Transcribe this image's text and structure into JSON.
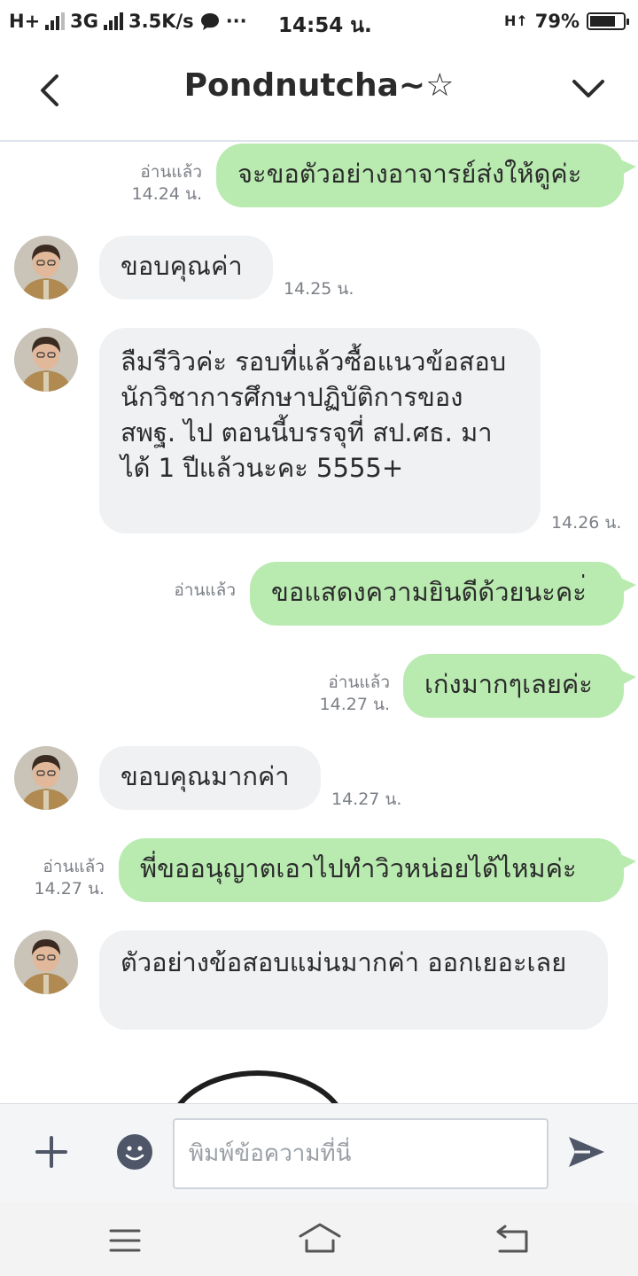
{
  "status_bar": {
    "left_network": "H+",
    "network_type": "3G",
    "speed": "3.5K/s",
    "more": "···",
    "time": "14:54 น.",
    "right_network": "H↑",
    "battery_percent_text": "79%",
    "battery_level": 0.79
  },
  "header": {
    "title": "Pondnutcha~☆",
    "back_icon": "chevron-left-icon",
    "menu_icon": "chevron-down-icon"
  },
  "messages": [
    {
      "dir": "out",
      "text": "จะขอตัวอย่างอาจารย์ส่งให้ดูค่ะ",
      "read": "อ่านแล้ว",
      "time": "14.24 น."
    },
    {
      "dir": "in",
      "text": "ขอบคุณค่า",
      "time": "14.25 น."
    },
    {
      "dir": "in",
      "text": "ลืมรีวิวค่ะ รอบที่แล้วซื้อแนวข้อสอบนักวิชาการศึกษาปฏิบัติการของ สพฐ. ไป ตอนนี้บรรจุที่ สป.ศธ. มาได้ 1 ปีแล้วนะคะ 5555+",
      "time": "14.26 น."
    },
    {
      "dir": "out",
      "text": "ขอแสดงความยินดีด้วยนะคะ่",
      "read": "อ่านแล้ว",
      "time": ""
    },
    {
      "dir": "out",
      "text": "เก่งมากๆเลยค่ะ",
      "read": "อ่านแล้ว",
      "time": "14.27 น."
    },
    {
      "dir": "in",
      "text": "ขอบคุณมากค่า",
      "time": "14.27 น."
    },
    {
      "dir": "out",
      "text": "พี่ขออนุญาตเอาไปทำวิวหน่อยได้ไหมค่ะ",
      "read": "อ่านแล้ว",
      "time": "14.27 น."
    },
    {
      "dir": "in",
      "text": "ตัวอย่างข้อสอบแม่นมากค่า ออกเยอะเลย",
      "time": ""
    }
  ],
  "input": {
    "placeholder": "พิมพ์ข้อความที่นี่",
    "add_icon": "plus-icon",
    "emoji_icon": "emoji-icon",
    "send_icon": "send-icon"
  },
  "nav": {
    "menu_icon": "menu-icon",
    "home_icon": "home-icon",
    "back_icon": "back-icon"
  },
  "colors": {
    "outgoing_bubble": "#b9ebb1",
    "incoming_bubble": "#f0f1f3",
    "meta_text": "#7b7f86",
    "icon": "#4e5668"
  }
}
